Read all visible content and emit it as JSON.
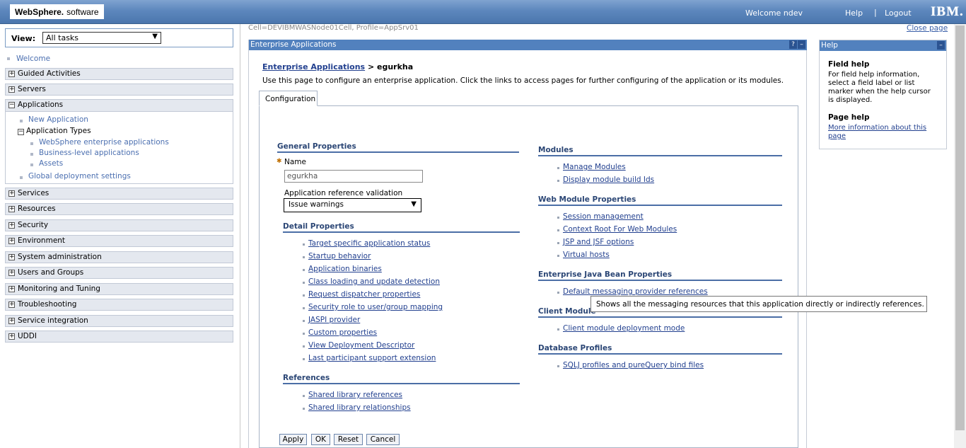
{
  "banner": {
    "brand_bold": "WebSphere.",
    "brand_rest": "software",
    "welcome": "Welcome ndev",
    "help": "Help",
    "separator": "|",
    "logout": "Logout",
    "ibm": "IBM."
  },
  "nav": {
    "view_label": "View:",
    "view_value": "All tasks",
    "welcome": "Welcome",
    "sections": [
      "Guided Activities",
      "Servers",
      "Applications",
      "Services",
      "Resources",
      "Security",
      "Environment",
      "System administration",
      "Users and Groups",
      "Monitoring and Tuning",
      "Troubleshooting",
      "Service integration",
      "UDDI"
    ],
    "applications": {
      "new_application": "New Application",
      "application_types": "Application Types",
      "websphere_apps": "WebSphere enterprise applications",
      "business_level": "Business-level applications",
      "assets": "Assets",
      "global_deployment": "Global deployment settings"
    }
  },
  "main": {
    "breadcrumb": "Cell=DEVIBMWASNode01Cell, Profile=AppSrv01",
    "close_page": "Close page",
    "panel_title": "Enterprise Applications",
    "heading_link": "Enterprise Applications",
    "heading_rest": " > egurkha",
    "intro": "Use this page to configure an enterprise application. Click the links to access pages for further configuring of the application or its modules.",
    "tab": "Configuration",
    "general_properties": "General Properties",
    "name_label": "Name",
    "name_value": "egurkha",
    "validation_label": "Application reference validation",
    "validation_value": "Issue warnings",
    "detail_properties": "Detail Properties",
    "detail_links": [
      "Target specific application status",
      "Startup behavior",
      "Application binaries",
      "Class loading and update detection",
      "Request dispatcher properties",
      "Security role to user/group mapping",
      "JASPI provider",
      "Custom properties",
      "View Deployment Descriptor",
      "Last participant support extension"
    ],
    "references": "References",
    "reference_links": [
      "Shared library references",
      "Shared library relationships"
    ],
    "modules": "Modules",
    "module_links": [
      "Manage Modules",
      "Display module build Ids"
    ],
    "web_module_properties": "Web Module Properties",
    "web_links": [
      "Session management",
      "Context Root For Web Modules",
      "JSP and JSF options",
      "Virtual hosts"
    ],
    "ejb_properties": "Enterprise Java Bean Properties",
    "ejb_links": [
      "Default messaging provider references"
    ],
    "client_module": "Client Module",
    "client_links": [
      "Client module deployment mode"
    ],
    "database_profiles": "Database Profiles",
    "db_links": [
      "SQLJ profiles and pureQuery bind files"
    ],
    "buttons": {
      "apply": "Apply",
      "ok": "OK",
      "reset": "Reset",
      "cancel": "Cancel"
    }
  },
  "help": {
    "title": "Help",
    "field_help": "Field help",
    "field_help_text": "For field help information, select a field label or list marker when the help cursor is displayed.",
    "page_help": "Page help",
    "page_help_link": "More information about this page"
  },
  "tooltip": "Shows all the messaging resources that this application directly or indirectly references."
}
